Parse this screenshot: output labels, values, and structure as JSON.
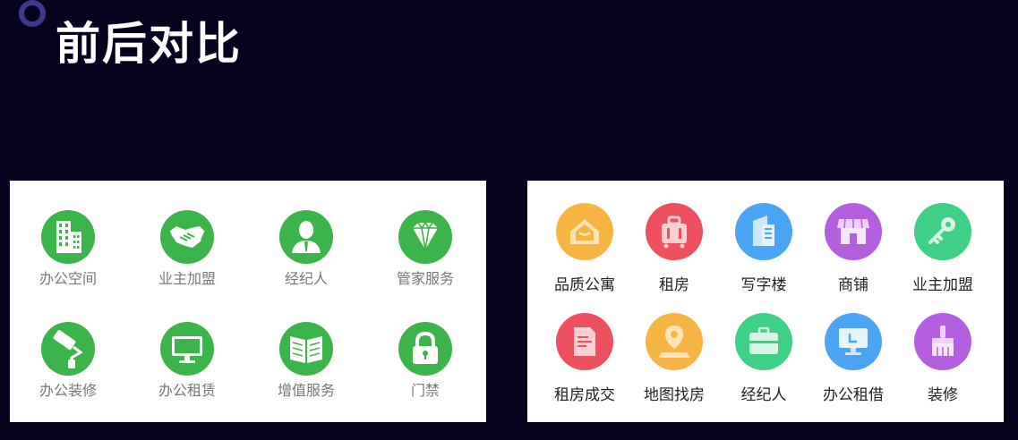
{
  "page": {
    "title": "前后对比"
  },
  "before": {
    "items": [
      {
        "label": "办公空间",
        "icon": "office-building-icon"
      },
      {
        "label": "业主加盟",
        "icon": "handshake-icon"
      },
      {
        "label": "经纪人",
        "icon": "agent-person-icon"
      },
      {
        "label": "管家服务",
        "icon": "diamond-icon"
      },
      {
        "label": "办公装修",
        "icon": "paint-roller-icon"
      },
      {
        "label": "办公租赁",
        "icon": "monitor-icon"
      },
      {
        "label": "增值服务",
        "icon": "open-book-icon"
      },
      {
        "label": "门禁",
        "icon": "padlock-icon"
      }
    ],
    "icon_color": "#3bb54a"
  },
  "after": {
    "items": [
      {
        "label": "品质公寓",
        "icon": "house-icon",
        "color": "#f8b544"
      },
      {
        "label": "租房",
        "icon": "luggage-icon",
        "color": "#ef5060"
      },
      {
        "label": "写字楼",
        "icon": "office-tower-icon",
        "color": "#4aa6f5"
      },
      {
        "label": "商铺",
        "icon": "storefront-icon",
        "color": "#b45fe0"
      },
      {
        "label": "业主加盟",
        "icon": "key-icon",
        "color": "#3fcf86"
      },
      {
        "label": "租房成交",
        "icon": "document-icon",
        "color": "#ef5060"
      },
      {
        "label": "地图找房",
        "icon": "map-pin-icon",
        "color": "#f8b544"
      },
      {
        "label": "经纪人",
        "icon": "briefcase-icon",
        "color": "#3fcf86"
      },
      {
        "label": "办公租借",
        "icon": "desktop-computer-icon",
        "color": "#4aa6f5"
      },
      {
        "label": "装修",
        "icon": "paint-brush-icon",
        "color": "#b45fe0"
      }
    ]
  }
}
